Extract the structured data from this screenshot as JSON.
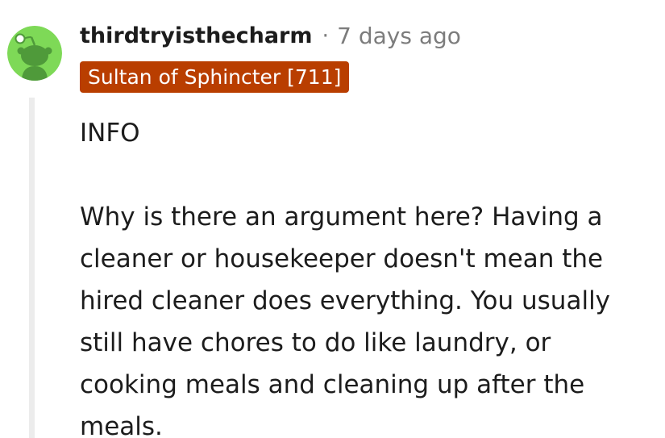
{
  "comment": {
    "username": "thirdtryisthecharm",
    "separator": "·",
    "timestamp": "7 days ago",
    "flair": "Sultan of Sphincter [711]",
    "avatar_icon": "snoo-avatar-icon",
    "colors": {
      "avatar_bg": "#7ed957",
      "avatar_figure": "#4f9a3a",
      "flair_bg": "#b93e00",
      "thread_line": "#ececec"
    },
    "paragraphs": [
      "INFO",
      "Why is there an argument here? Having a cleaner or housekeeper doesn't mean the hired cleaner does everything. You usually still have chores to do like laundry, or cooking meals and cleaning up after the meals."
    ]
  }
}
